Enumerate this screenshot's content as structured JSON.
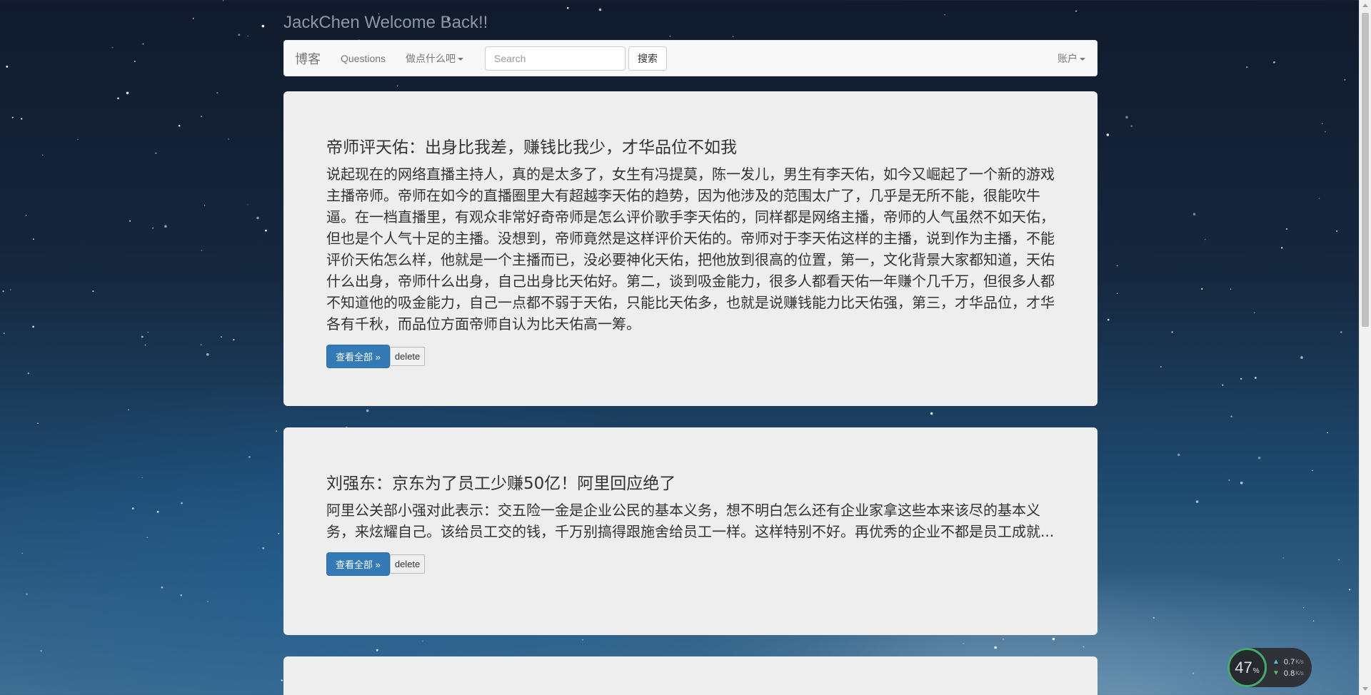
{
  "header": {
    "welcome": "JackChen Welcome Back!!"
  },
  "navbar": {
    "brand": "博客",
    "questions": "Questions",
    "dropdown": "做点什么吧",
    "search_placeholder": "Search",
    "search_button": "搜索",
    "account": "账户"
  },
  "posts": [
    {
      "title": "帝师评天佑：出身比我差，赚钱比我少，才华品位不如我",
      "body": "说起现在的网络直播主持人，真的是太多了，女生有冯提莫，陈一发儿，男生有李天佑，如今又崛起了一个新的游戏主播帝师。帝师在如今的直播圈里大有超越李天佑的趋势，因为他涉及的范围太广了，几乎是无所不能，很能吹牛逼。在一档直播里，有观众非常好奇帝师是怎么评价歌手李天佑的，同样都是网络主播，帝师的人气虽然不如天佑，但也是个人气十足的主播。没想到，帝师竟然是这样评价天佑的。帝师对于李天佑这样的主播，说到作为主播，不能评价天佑怎么样，他就是一个主播而已，没必要神化天佑，把他放到很高的位置，第一，文化背景大家都知道，天佑什么出身，帝师什么出身，自己出身比天佑好。第二，谈到吸金能力，很多人都看天佑一年赚个几千万，但很多人都不知道他的吸金能力，自己一点都不弱于天佑，只能比天佑多，也就是说赚钱能力比天佑强，第三，才华品位，才华各有千秋，而品位方面帝师自认为比天佑高一筹。",
      "view_all": "查看全部 »",
      "delete": "delete"
    },
    {
      "title": "刘强东：京东为了员工少赚50亿！阿里回应绝了",
      "body": "阿里公关部小强对此表示：交五险一金是企业公民的基本义务，想不明白怎么还有企业家拿这些本来该尽的基本义务，来炫耀自己。该给员工交的钱，千万别搞得跟施舍给员工一样。这样特别不好。再优秀的企业不都是员工成就...",
      "view_all": "查看全部 »",
      "delete": "delete"
    }
  ],
  "net_widget": {
    "percent": "47",
    "percent_unit": "%",
    "up_value": "0.7",
    "down_value": "0.8",
    "rate_unit": "K/s",
    "up_icon": "up-arrow-icon",
    "down_icon": "down-arrow-icon"
  },
  "colors": {
    "primary": "#337ab7",
    "card": "#eeeeee",
    "navbar": "#f8f8f8"
  }
}
